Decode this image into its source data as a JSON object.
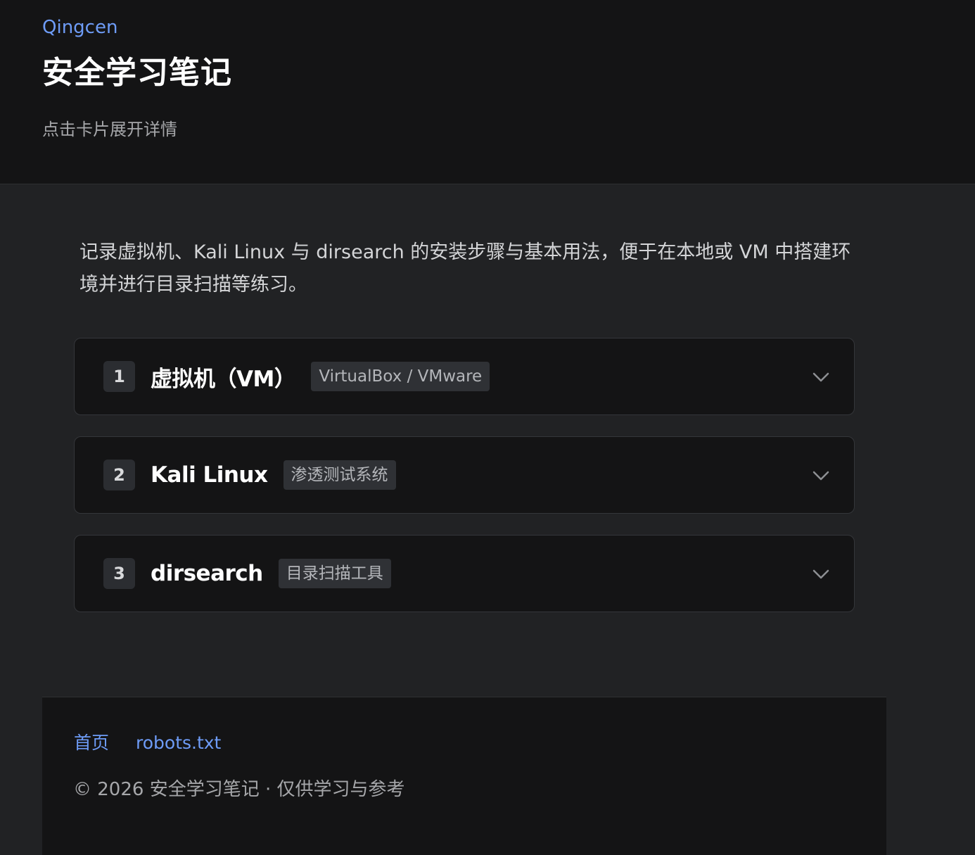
{
  "header": {
    "brand": "Qingcen",
    "title": "安全学习笔记",
    "subtitle": "点击卡片展开详情"
  },
  "intro": "记录虚拟机、Kali Linux 与 dirsearch 的安装步骤与基本用法，便于在本地或 VM 中搭建环境并进行目录扫描等练习。",
  "cards": [
    {
      "number": "1",
      "title": "虚拟机（VM）",
      "tag": "VirtualBox / VMware",
      "expand_icon": "chevron-down-icon"
    },
    {
      "number": "2",
      "title": "Kali Linux",
      "tag": "渗透测试系统",
      "expand_icon": "chevron-down-icon"
    },
    {
      "number": "3",
      "title": "dirsearch",
      "tag": "目录扫描工具",
      "expand_icon": "chevron-down-icon"
    }
  ],
  "footer": {
    "links": [
      "首页",
      "robots.txt"
    ],
    "copyright": "© 2026 安全学习笔记 · 仅供学习与参考"
  },
  "colors": {
    "accent": "#6e9cf7",
    "page_bg": "#212224",
    "panel_bg": "#141415"
  }
}
